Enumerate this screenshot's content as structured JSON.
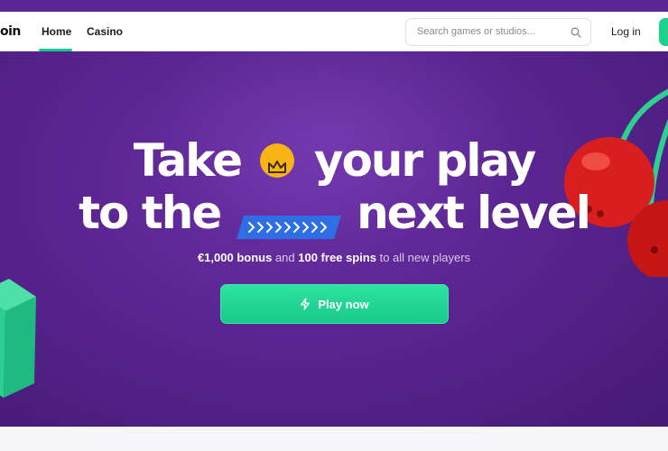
{
  "brand": {
    "logo_text": "oin"
  },
  "nav": {
    "home_label": "Home",
    "casino_label": "Casino",
    "active": "Home"
  },
  "search": {
    "placeholder": "Search games or studios..."
  },
  "auth": {
    "login_label": "Log in"
  },
  "hero": {
    "line1_part1": "Take",
    "line1_part2": "your play",
    "line2_part1": "to the",
    "line2_part2": "next level",
    "subtitle_bonus": "€1,000 bonus",
    "subtitle_and": " and ",
    "subtitle_spins": "100 free spins",
    "subtitle_rest": " to all new players",
    "cta_label": "Play now"
  },
  "icons": {
    "search": "search-icon",
    "crown": "crown-icon",
    "arrows": "arrows-icon",
    "bolt": "lightning-icon"
  },
  "colors": {
    "accent_green": "#19c98a",
    "hero_purple": "#5a2590",
    "crown_yellow": "#f7b515",
    "arrows_blue": "#2f6fe6"
  }
}
